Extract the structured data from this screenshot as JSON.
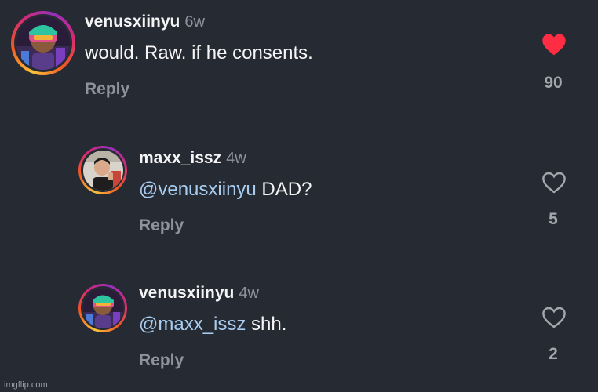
{
  "comments": [
    {
      "username": "venusxiinyu",
      "age": "6w",
      "mention": "",
      "text": "would. Raw. if he consents.",
      "reply_label": "Reply",
      "like_count": "90",
      "liked": true
    },
    {
      "username": "maxx_issz",
      "age": "4w",
      "mention": "@venusxiinyu",
      "text": " DAD?",
      "reply_label": "Reply",
      "like_count": "5",
      "liked": false
    },
    {
      "username": "venusxiinyu",
      "age": "4w",
      "mention": "@maxx_issz",
      "text": " shh.",
      "reply_label": "Reply",
      "like_count": "2",
      "liked": false
    }
  ],
  "colors": {
    "background": "#262a32",
    "heart_liked": "#ff2d44",
    "mention": "#a8cdf0",
    "muted": "#8e939b"
  },
  "icons": [
    "avatar-photo",
    "heart-filled-icon",
    "heart-outline-icon"
  ],
  "watermark": "imgflip.com"
}
